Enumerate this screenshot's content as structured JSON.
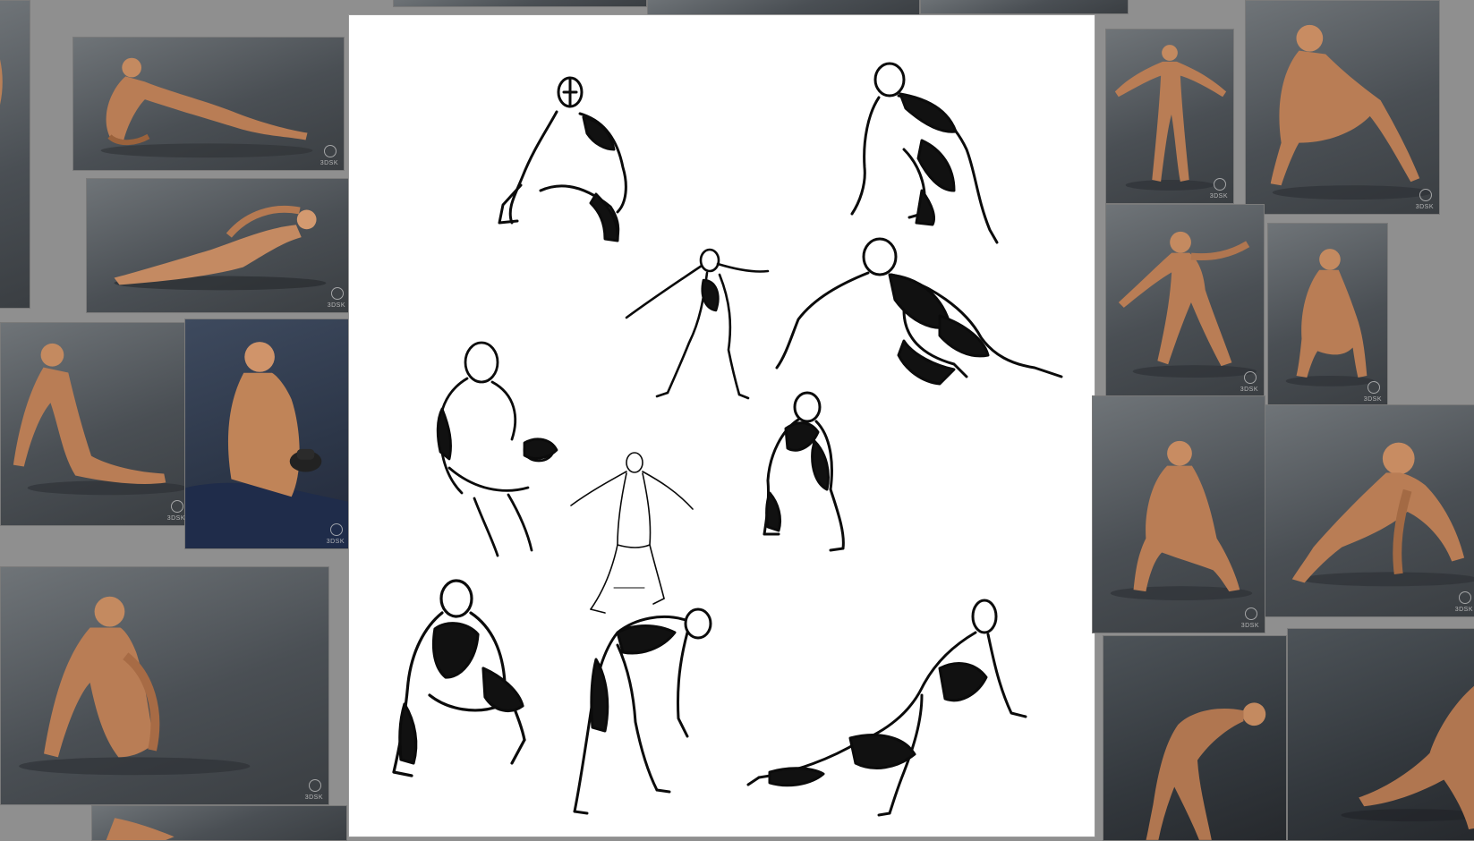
{
  "page": {
    "background_color": "#8f8f8f",
    "canvas_color": "#ffffff",
    "ink_color": "#0b0b0b"
  },
  "reference_photos": [
    {
      "id": "reclining-left-elbow",
      "pose": "reclining on left elbow",
      "watermark": "3DSK"
    },
    {
      "id": "reclining-hand-on-head",
      "pose": "reclining, hand on head",
      "watermark": "3DSK"
    },
    {
      "id": "seated-leaning-back",
      "pose": "seated leaning back",
      "watermark": "3DSK"
    },
    {
      "id": "seated-holding-hat",
      "pose": "seated holding hat",
      "watermark": "3DSK"
    },
    {
      "id": "crouching-front",
      "pose": "crouching",
      "watermark": "3DSK"
    },
    {
      "id": "standing-arms-out",
      "pose": "standing arms out",
      "watermark": "3DSK"
    },
    {
      "id": "kneeling-hand-to-mouth",
      "pose": "kneeling hand to mouth",
      "watermark": "3DSK"
    },
    {
      "id": "lunging-arm-out",
      "pose": "lunging, arm extended",
      "watermark": "3DSK"
    },
    {
      "id": "kneeling-thinking",
      "pose": "kneeling, hand to chin",
      "watermark": "3DSK"
    },
    {
      "id": "crouching-hands-on-knee",
      "pose": "crouching, hands on knee",
      "watermark": "3DSK"
    },
    {
      "id": "crawling-forward",
      "pose": "crawling forward",
      "watermark": "3DSK"
    },
    {
      "id": "bending-over",
      "pose": "bending over",
      "watermark": "3DSK"
    },
    {
      "id": "crawling-cropped",
      "pose": "crawling",
      "watermark": "3DSK"
    }
  ],
  "sketches": [
    {
      "id": "sketch-kneeling-squat"
    },
    {
      "id": "sketch-crouching-reach"
    },
    {
      "id": "sketch-arms-out-lunge"
    },
    {
      "id": "sketch-crawling-lunge"
    },
    {
      "id": "sketch-seated-hat"
    },
    {
      "id": "sketch-standing-arms-out"
    },
    {
      "id": "sketch-kneeling-hand-mouth"
    },
    {
      "id": "sketch-crouch-front"
    },
    {
      "id": "sketch-bending-over"
    },
    {
      "id": "sketch-reclining-crawl"
    }
  ]
}
